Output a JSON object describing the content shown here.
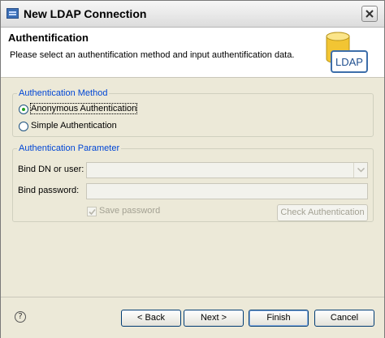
{
  "window": {
    "title": "New LDAP Connection"
  },
  "banner": {
    "title": "Authentification",
    "description": "Please select an authentification method and input authentification data.",
    "icon_label": "LDAP"
  },
  "auth_method": {
    "legend": "Authentication Method",
    "options": [
      {
        "label": "Anonymous Authentication",
        "checked": true
      },
      {
        "label": "Simple Authentication",
        "checked": false
      }
    ]
  },
  "auth_param": {
    "legend": "Authentication Parameter",
    "bind_dn_label": "Bind DN or user:",
    "bind_dn_value": "",
    "bind_password_label": "Bind password:",
    "bind_password_value": "",
    "save_password_label": "Save password",
    "save_password_checked": true,
    "check_button_label": "Check Authentication"
  },
  "footer": {
    "help_icon": "?",
    "back_label": "< Back",
    "next_label": "Next >",
    "finish_label": "Finish",
    "cancel_label": "Cancel"
  },
  "colors": {
    "legend": "#0046d5",
    "disabled_text": "#a3a193",
    "dialog_bg": "#ece9d8"
  }
}
